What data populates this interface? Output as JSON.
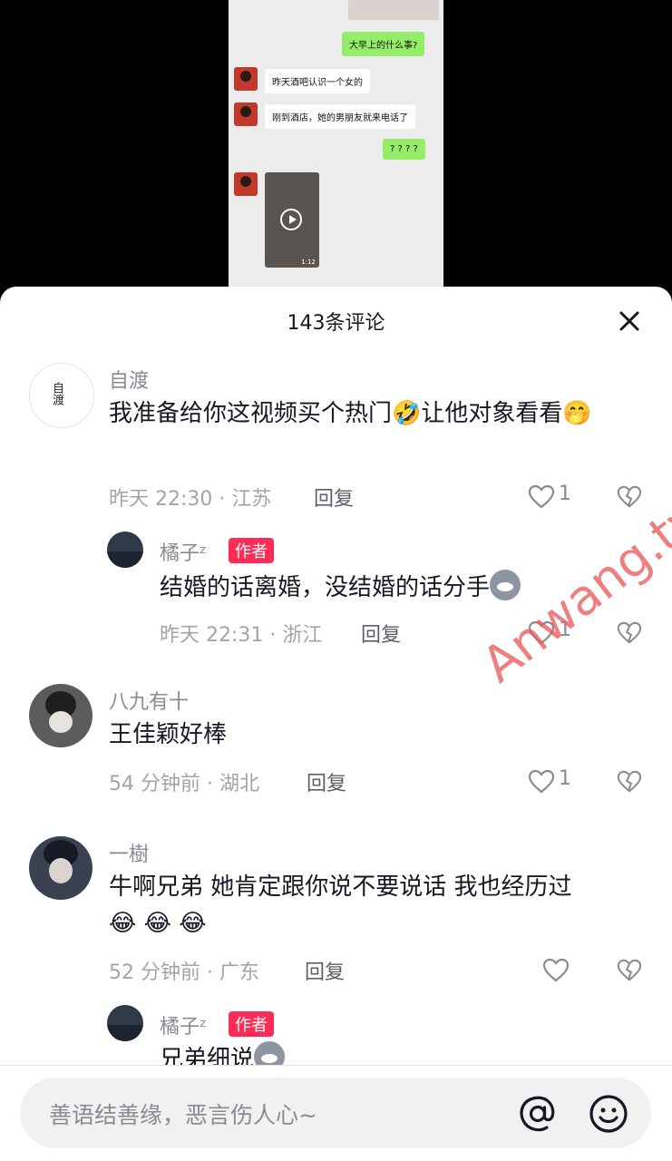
{
  "chat_preview": {
    "messages": [
      {
        "side": "right",
        "text": "大早上的什么事?"
      },
      {
        "side": "left",
        "text": "昨天酒吧认识一个女的"
      },
      {
        "side": "left",
        "text": "刚到酒店，她的男朋友就来电话了"
      },
      {
        "side": "right",
        "text": "? ? ? ?"
      }
    ],
    "video_duration": "1:12"
  },
  "sheet": {
    "title": "143条评论"
  },
  "comments": [
    {
      "username": "自渡",
      "avatar_text": "自渡",
      "text": "我准备给你这视频买个热门🤣让他对象看看🤭",
      "time": "昨天 22:30 · 江苏",
      "reply": "回复",
      "likes": "1"
    },
    {
      "username": "橘子ᶻ",
      "badge": "作者",
      "text": "结婚的话离婚，没结婚的话分手",
      "time": "昨天 22:31 · 浙江",
      "reply": "回复",
      "likes": "1"
    },
    {
      "username": "八九有十",
      "text": "王佳颖好棒",
      "time": "54 分钟前 · 湖北",
      "reply": "回复",
      "likes": "1"
    },
    {
      "username": "一樹",
      "text": "牛啊兄弟 她肯定跟你说不要说话 我也经历过",
      "emoji_line": "😂 😂 😂",
      "time": "52 分钟前 · 广东",
      "reply": "回复",
      "likes": ""
    },
    {
      "username": "橘子ᶻ",
      "badge": "作者",
      "text": "兄弟细说"
    }
  ],
  "input": {
    "placeholder": "善语结善缘，恶言伤人心~"
  },
  "watermark": "Anwang.tv",
  "colors": {
    "accent": "#fe2c55",
    "bubble_green": "#95ec69"
  }
}
